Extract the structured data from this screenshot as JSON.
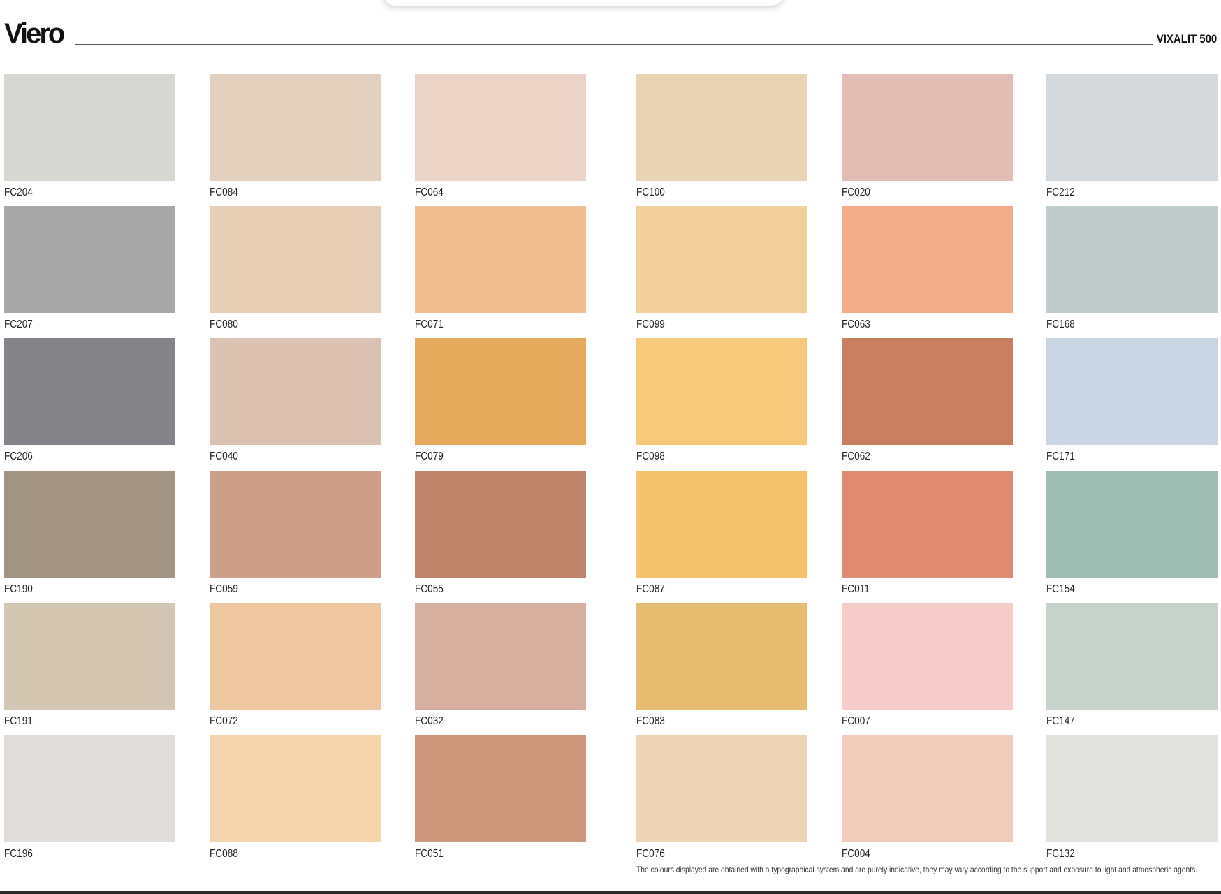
{
  "brand": {
    "logo_text": "Viero",
    "collection": "VIXALIT 500"
  },
  "swatches": [
    {
      "code": "FC204",
      "color": "#d7d7d2"
    },
    {
      "code": "FC084",
      "color": "#e3d0bf"
    },
    {
      "code": "FC064",
      "color": "#ebd3c8"
    },
    {
      "code": "FC100",
      "color": "#e8d4b3"
    },
    {
      "code": "FC020",
      "color": "#e2bcb5"
    },
    {
      "code": "FC212",
      "color": "#d3d8dd"
    },
    {
      "code": "FC207",
      "color": "#a7a8a8"
    },
    {
      "code": "FC080",
      "color": "#e6cdb6"
    },
    {
      "code": "FC071",
      "color": "#efbd90"
    },
    {
      "code": "FC099",
      "color": "#f1cf9b"
    },
    {
      "code": "FC063",
      "color": "#f4ad88"
    },
    {
      "code": "FC168",
      "color": "#bdcccb"
    },
    {
      "code": "FC206",
      "color": "#858289"
    },
    {
      "code": "FC040",
      "color": "#dbc1b2"
    },
    {
      "code": "FC079",
      "color": "#e6a85d"
    },
    {
      "code": "FC098",
      "color": "#f6c97c"
    },
    {
      "code": "FC062",
      "color": "#c97e5f"
    },
    {
      "code": "FC171",
      "color": "#c8d6e4"
    },
    {
      "code": "FC190",
      "color": "#a39382"
    },
    {
      "code": "FC059",
      "color": "#cc9f86"
    },
    {
      "code": "FC055",
      "color": "#bf8467"
    },
    {
      "code": "FC087",
      "color": "#f4c26b"
    },
    {
      "code": "FC011",
      "color": "#e08a72"
    },
    {
      "code": "FC154",
      "color": "#9dbcaf"
    },
    {
      "code": "FC191",
      "color": "#d3c7b3"
    },
    {
      "code": "FC072",
      "color": "#eec7a1"
    },
    {
      "code": "FC032",
      "color": "#d8aea0"
    },
    {
      "code": "FC083",
      "color": "#e7bc72"
    },
    {
      "code": "FC007",
      "color": "#f7cbc8"
    },
    {
      "code": "FC147",
      "color": "#c5d3ca"
    },
    {
      "code": "FC196",
      "color": "#e2dcd8"
    },
    {
      "code": "FC088",
      "color": "#f4d3ad"
    },
    {
      "code": "FC051",
      "color": "#cc9879"
    },
    {
      "code": "FC076",
      "color": "#ecd4b4"
    },
    {
      "code": "FC004",
      "color": "#f1ccbc"
    },
    {
      "code": "FC132",
      "color": "#e2e1dc"
    }
  ],
  "disclaimer": "The colours displayed are obtained with a typographical system and are purely indicative, they may vary according to the support and exposure to light and atmospheric agents."
}
